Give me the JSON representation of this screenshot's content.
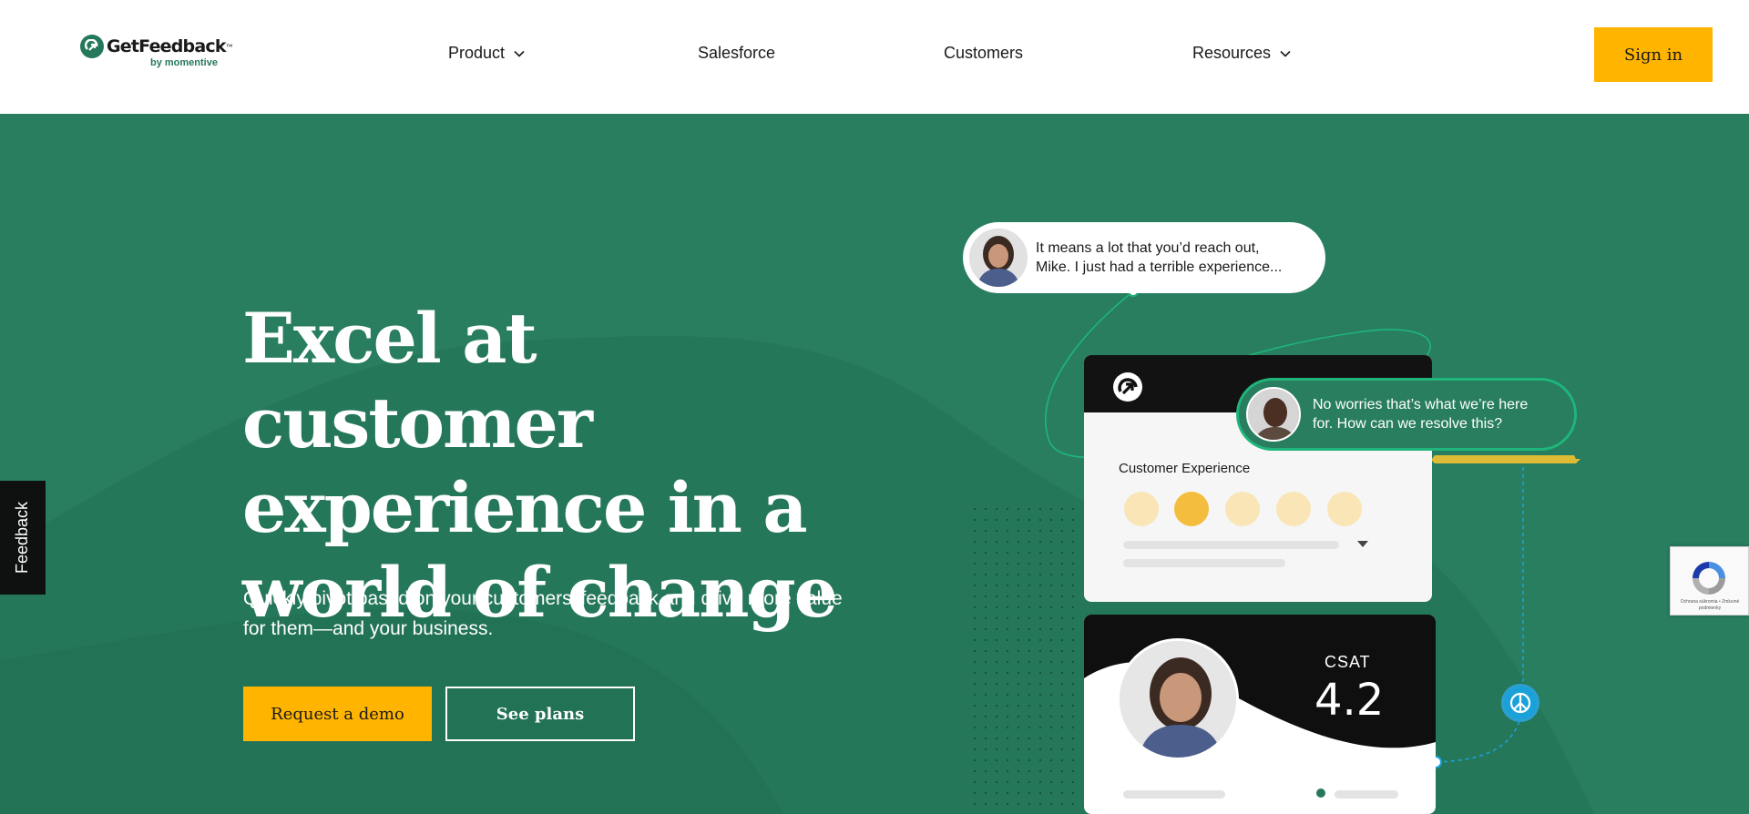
{
  "header": {
    "logo_text": "GetFeedback",
    "logo_trademark": "™",
    "logo_sub": "by momentive",
    "nav": [
      {
        "label": "Product",
        "has_dropdown": true
      },
      {
        "label": "Salesforce",
        "has_dropdown": false
      },
      {
        "label": "Customers",
        "has_dropdown": false
      },
      {
        "label": "Resources",
        "has_dropdown": true
      }
    ],
    "signin_label": "Sign in"
  },
  "hero": {
    "headline_lines": [
      "Excel at customer",
      "experience in a",
      "world of change"
    ],
    "subtext_lines": [
      "Quickly pivot based on your customers' feedback and drive more value",
      "for them—and your business."
    ],
    "demo_button": "Request a demo",
    "plans_button": "See plans"
  },
  "illustration": {
    "bubble_1": [
      "It means a lot that you’d reach out,",
      "Mike. I just had a terrible experience..."
    ],
    "bubble_2": [
      "No worries that’s what we’re here",
      "for. How can we resolve this?"
    ],
    "survey_title": "Customer Experience",
    "csat_label": "CSAT",
    "csat_value": "4.2"
  },
  "feedback_tab": "Feedback",
  "recaptcha_text": "Ochrana súkromia • Zmluvné podmienky",
  "colors": {
    "brand_green": "#287e5f",
    "accent_yellow": "#ffb400",
    "dark": "#121212",
    "chat_blue": "#1ba1d9"
  }
}
